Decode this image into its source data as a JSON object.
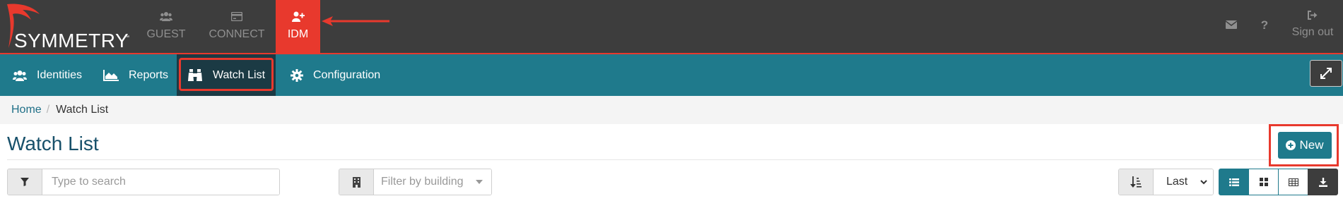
{
  "brand": {
    "name": "SYMMETRY",
    "tm": "™"
  },
  "top_nav": [
    {
      "label": "GUEST",
      "icon": "users-icon"
    },
    {
      "label": "CONNECT",
      "icon": "card-icon"
    },
    {
      "label": "IDM",
      "icon": "user-plus-icon",
      "active": true
    }
  ],
  "top_right": {
    "mail_icon": "envelope-icon",
    "help_label": "?",
    "signout_label": "Sign out"
  },
  "sub_nav": [
    {
      "label": "Identities",
      "icon": "users-icon"
    },
    {
      "label": "Reports",
      "icon": "area-chart-icon"
    },
    {
      "label": "Watch List",
      "icon": "binoculars-icon",
      "active": true
    },
    {
      "label": "Configuration",
      "icon": "gear-icon"
    }
  ],
  "breadcrumb": {
    "home": "Home",
    "separator": "/",
    "current": "Watch List"
  },
  "page": {
    "title": "Watch List",
    "new_label": "New"
  },
  "filters": {
    "search_placeholder": "Type to search",
    "building_placeholder": "Filter by building",
    "sort_value": "Last"
  },
  "views": [
    "list-view",
    "tile-view",
    "table-view",
    "download"
  ],
  "colors": {
    "topbar": "#3d3d3d",
    "accent_red": "#e8392d",
    "teal": "#1f7a8c",
    "active_dark": "#1b3a44",
    "title_blue": "#17506a"
  }
}
